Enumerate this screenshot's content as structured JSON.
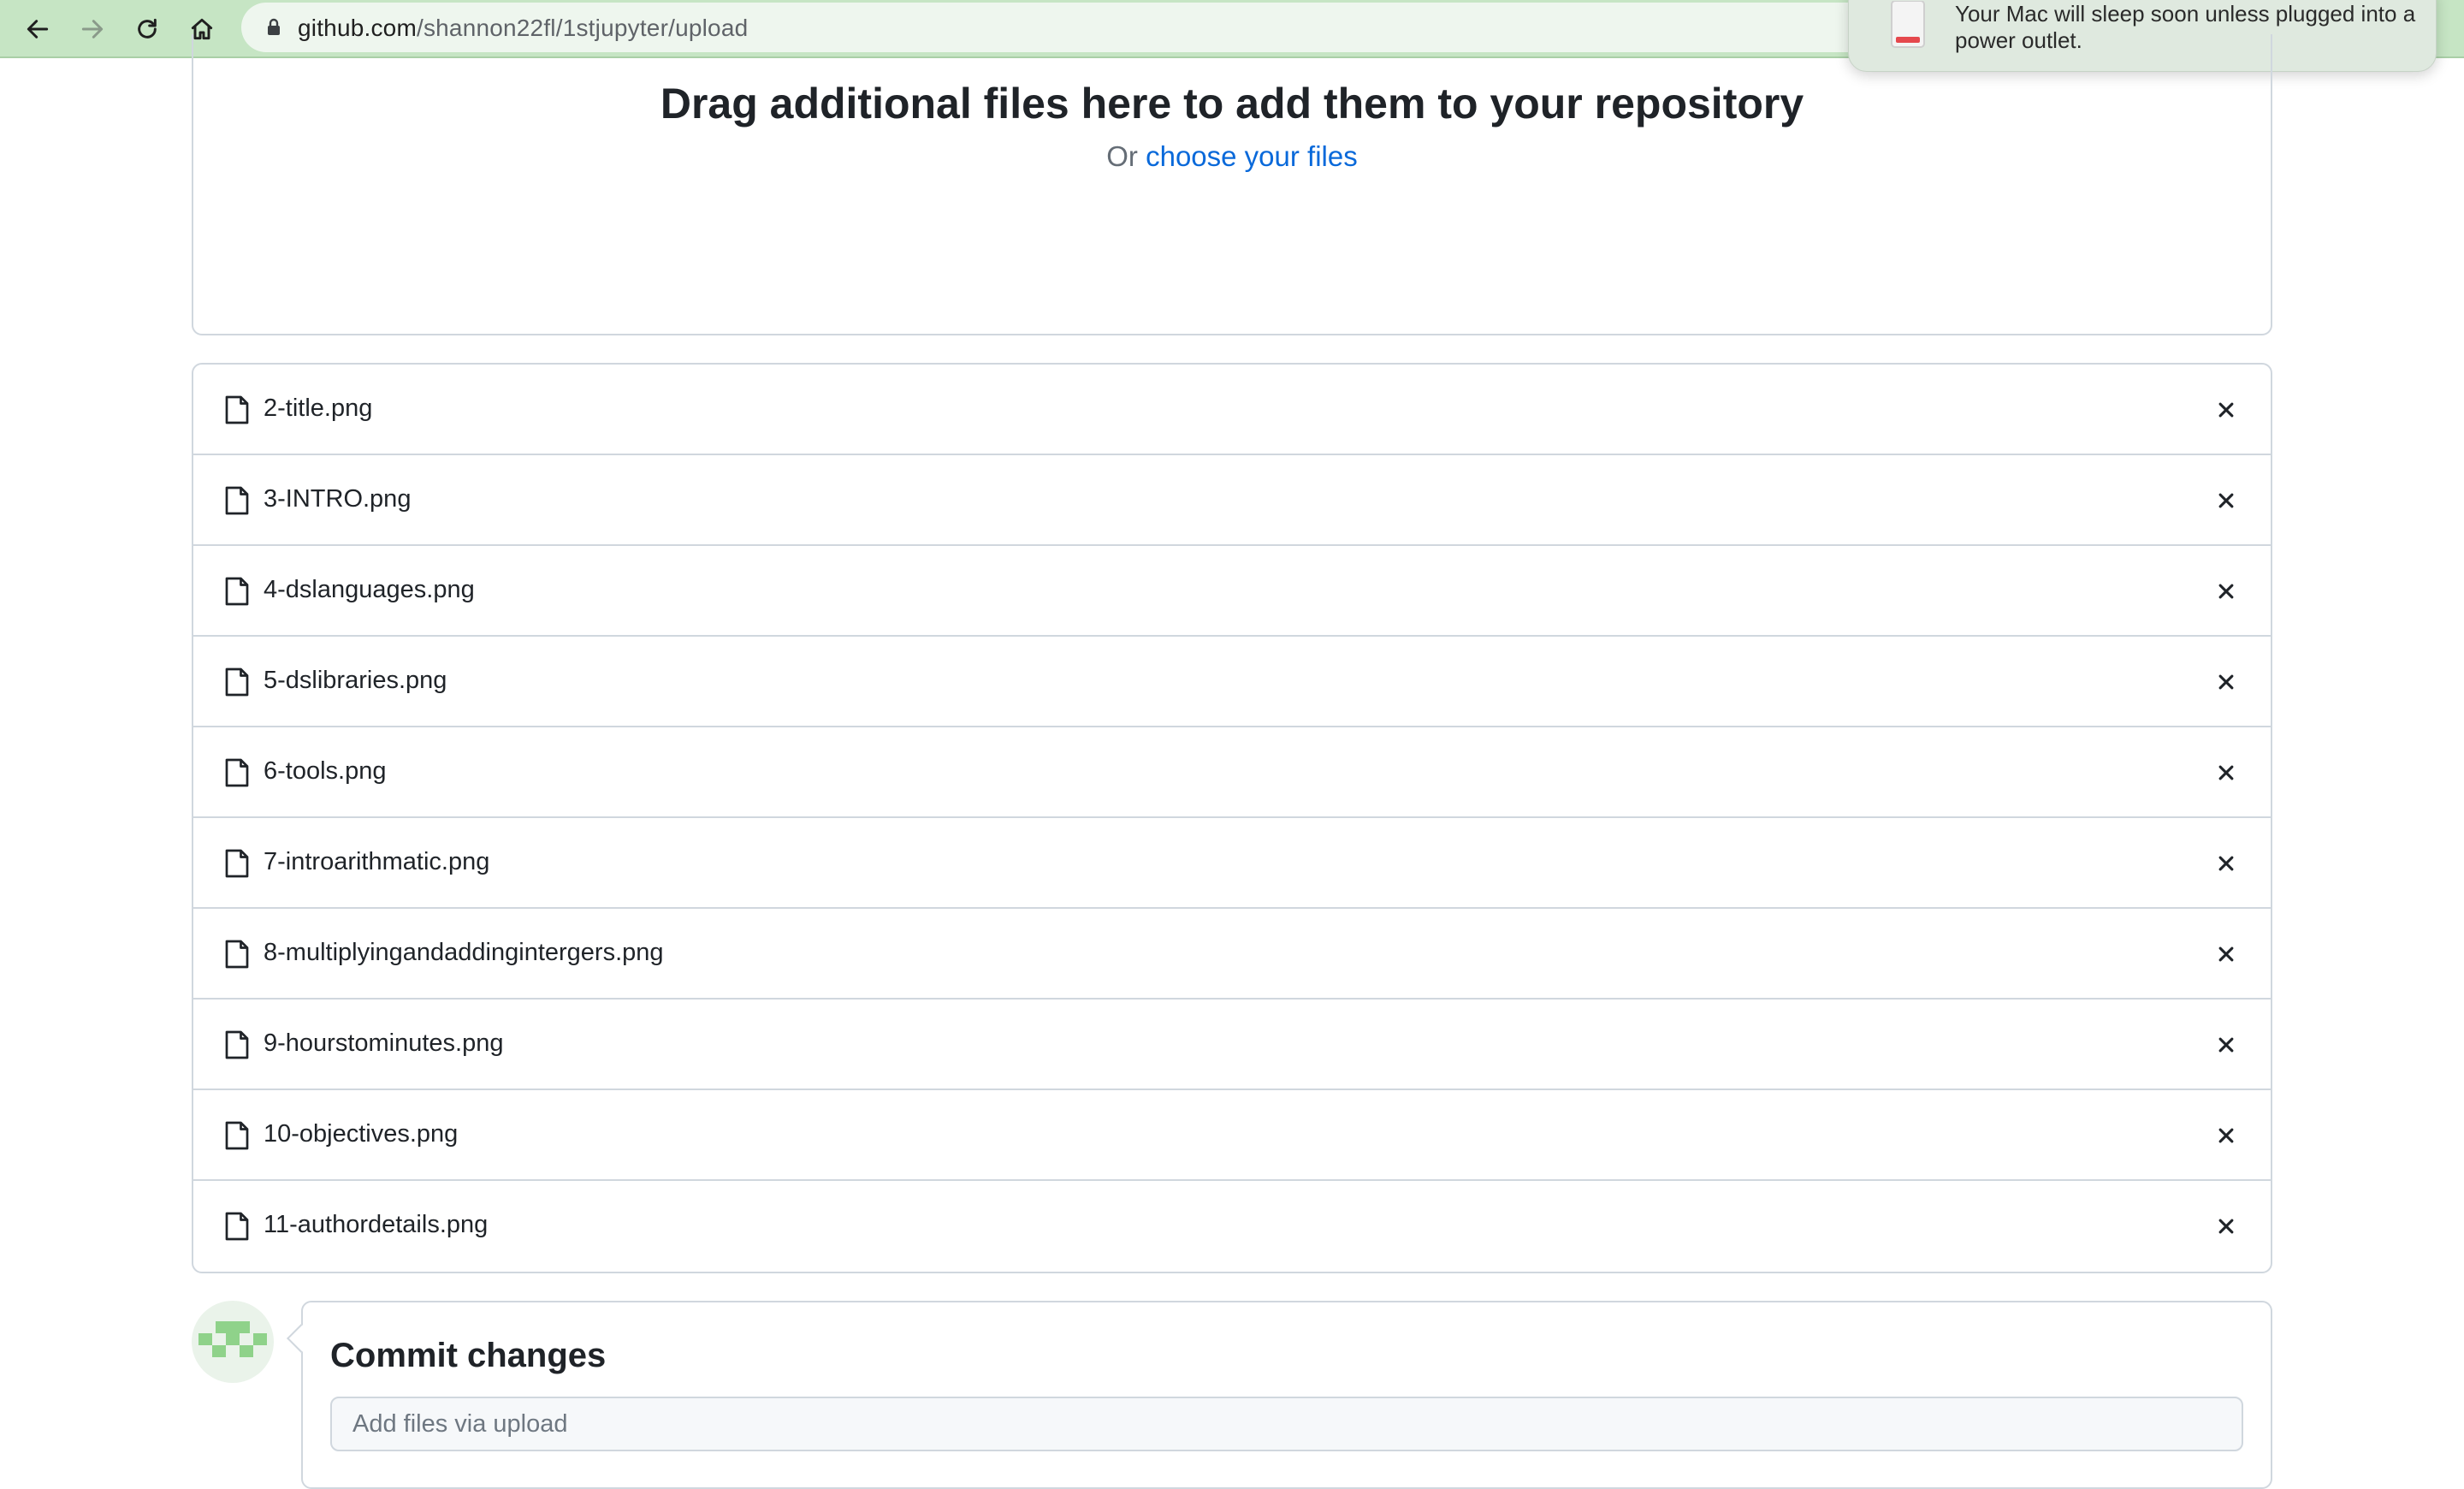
{
  "browser": {
    "url_host": "github.com",
    "url_path": "/shannon22fl/1stjupyter/upload"
  },
  "notification": {
    "message": "Your Mac will sleep soon unless plugged into a power outlet."
  },
  "dropzone": {
    "title": "Drag additional files here to add them to your repository",
    "prefix": "Or",
    "link": "choose your files"
  },
  "files": [
    {
      "name": "2-title.png"
    },
    {
      "name": "3-INTRO.png"
    },
    {
      "name": "4-dslanguages.png"
    },
    {
      "name": "5-dslibraries.png"
    },
    {
      "name": "6-tools.png"
    },
    {
      "name": "7-introarithmatic.png"
    },
    {
      "name": "8-multiplyingandaddingintergers.png"
    },
    {
      "name": "9-hourstominutes.png"
    },
    {
      "name": "10-objectives.png"
    },
    {
      "name": "11-authordetails.png"
    }
  ],
  "commit": {
    "title": "Commit changes",
    "placeholder": "Add files via upload"
  },
  "colors": {
    "toolbar": "#c6e5c4",
    "link": "#0969da",
    "border": "#d0d7de",
    "battery_low": "#e5484d",
    "avatar": "#8fd28a"
  }
}
